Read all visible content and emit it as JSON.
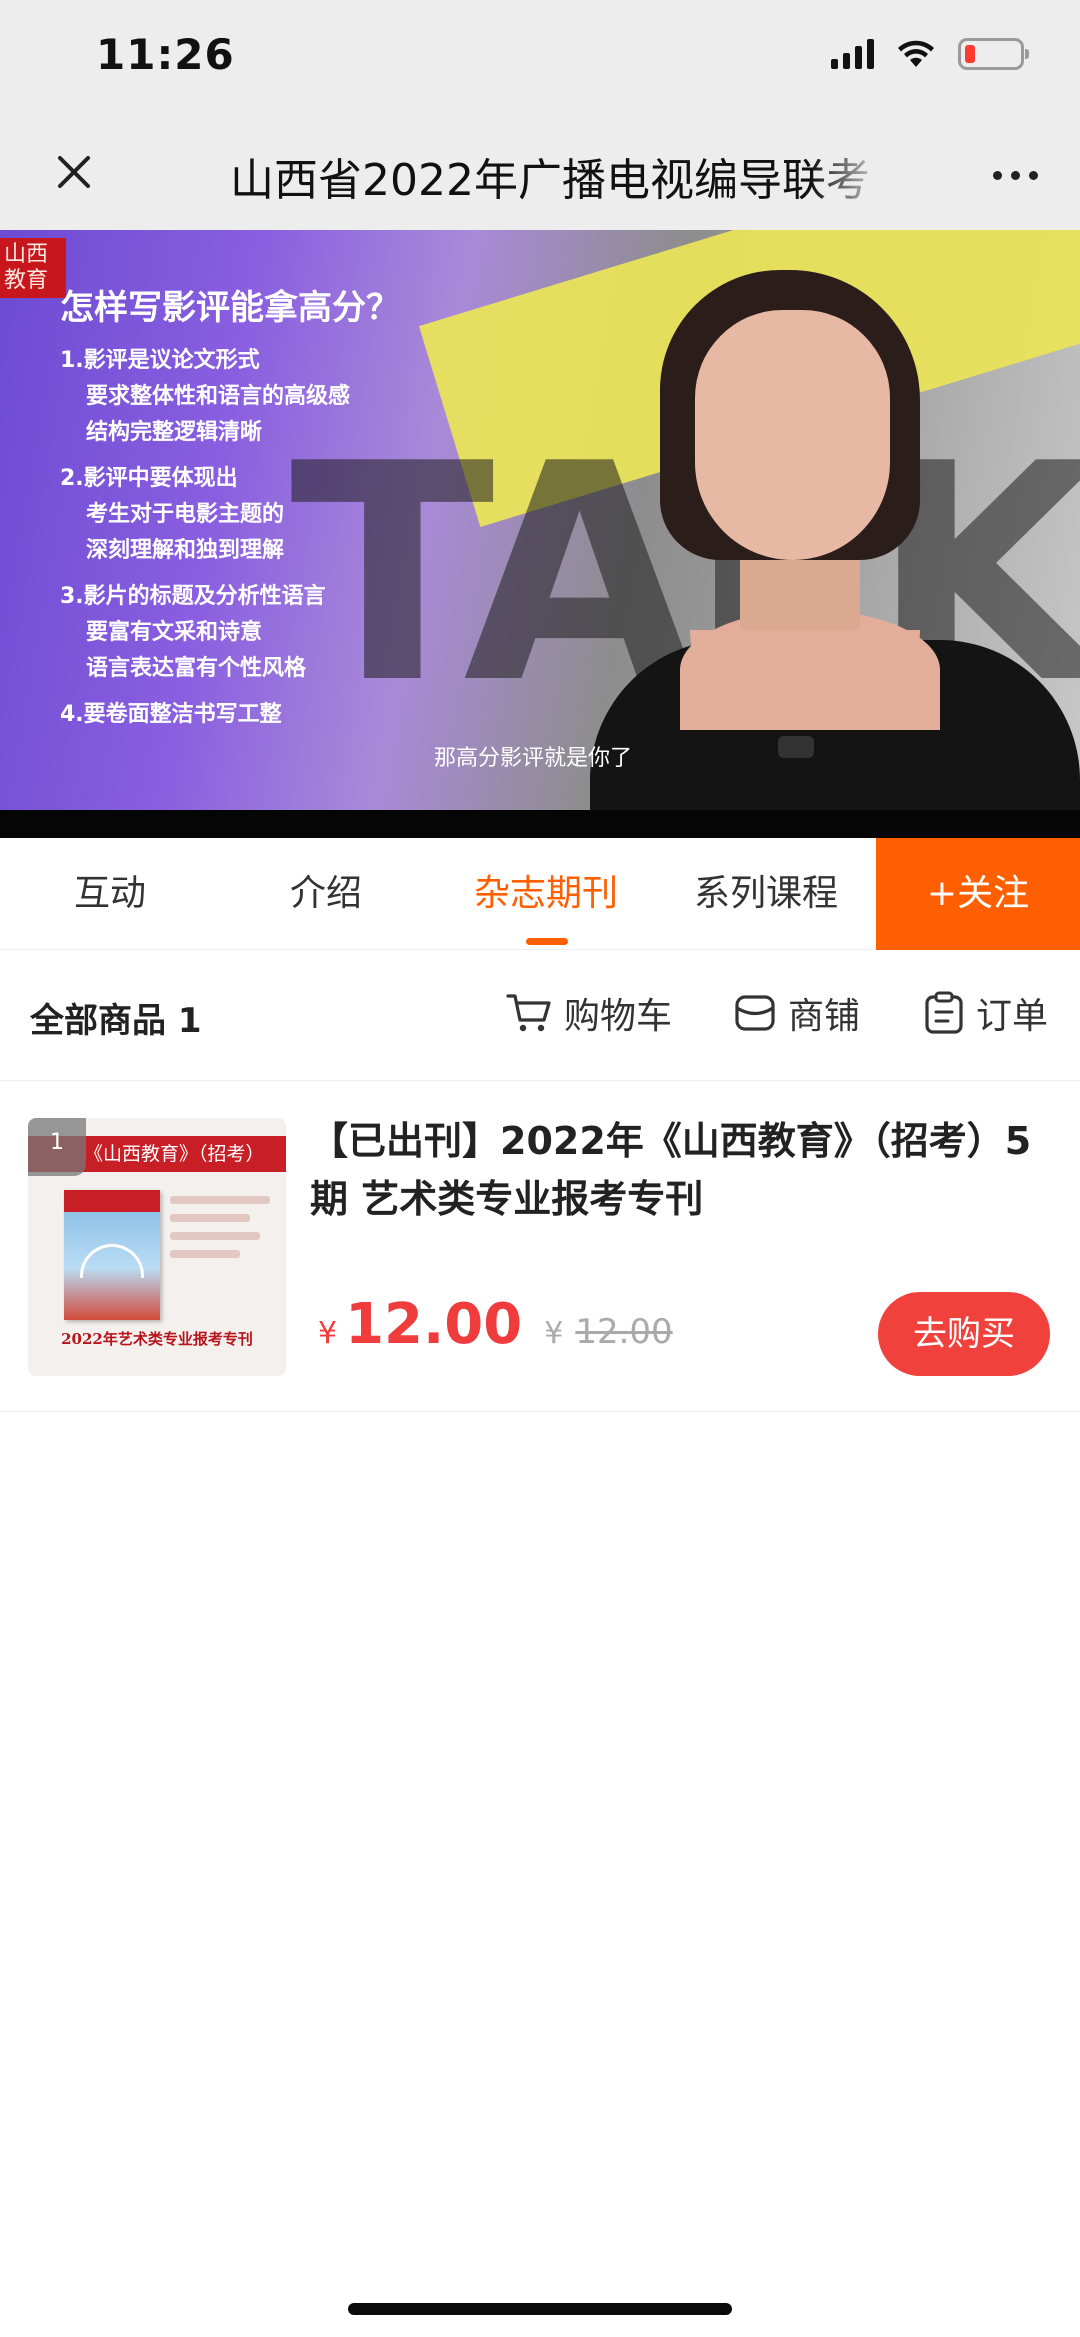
{
  "status_bar": {
    "time": "11:26"
  },
  "nav": {
    "title": "山西省2022年广播电视编导联考"
  },
  "video": {
    "question": "怎样写影评能拿高分？",
    "points": [
      [
        "1.影评是议论文形式",
        "  要求整体性和语言的高级感",
        "  结构完整逻辑清晰"
      ],
      [
        "2.影评中要体现出",
        "  考生对于电影主题的",
        "  深刻理解和独到理解"
      ],
      [
        "3.影片的标题及分析性语言",
        "  要富有文采和诗意",
        "  语言表达富有个性风格"
      ],
      [
        "4.要卷面整洁书写工整"
      ]
    ],
    "background_text": "TALK",
    "subtitle": "那高分影评就是你了"
  },
  "tabs": {
    "items": [
      {
        "label": "互动"
      },
      {
        "label": "介绍"
      },
      {
        "label": "杂志期刊"
      },
      {
        "label": "系列课程"
      }
    ],
    "active_index": 2,
    "follow_label": "+关注"
  },
  "shop": {
    "count_label": "全部商品 1",
    "cart_label": "购物车",
    "store_label": "商铺",
    "orders_label": "订单"
  },
  "product": {
    "index": "1",
    "thumb_header": "《山西教育》（招考）",
    "thumb_footer": "2022年艺术类专业报考专刊",
    "title": "【已出刊】2022年《山西教育》（招考）5期 艺术类专业报考专刊",
    "currency": "¥",
    "price": "12.00",
    "original_price": "12.00",
    "buy_label": "去购买"
  },
  "colors": {
    "accent": "#ff5f00",
    "price": "#f03c3c",
    "nav_bg": "#ededed"
  }
}
